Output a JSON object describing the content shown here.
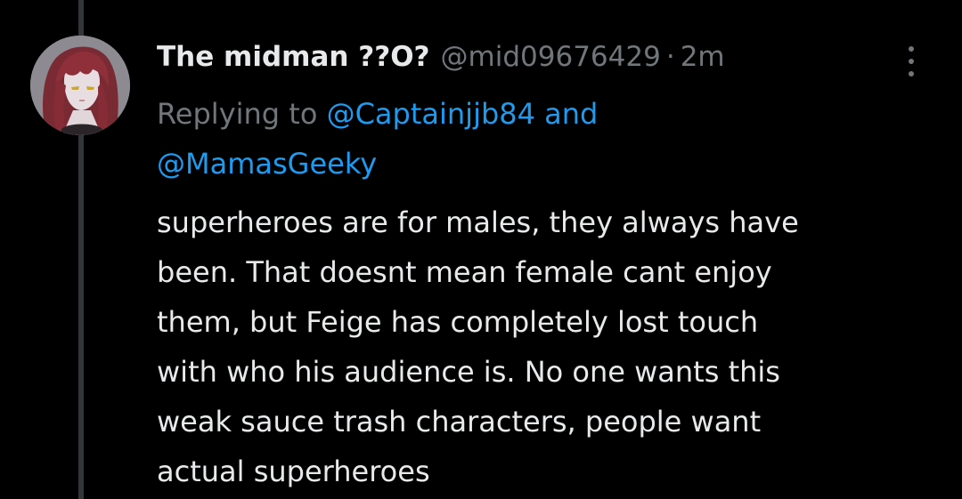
{
  "tweet": {
    "display_name": "The midman ??O?",
    "handle": "@mid09676429",
    "separator": "·",
    "time": "2m",
    "replying_prefix": "Replying to",
    "replying_mentions": [
      "@Captainjjb84",
      "@MamasGeeky"
    ],
    "replying_joiner": "and",
    "body_lines": [
      "superheroes are for males, they always have",
      "been. That doesnt mean female cant enjoy",
      "them, but Feige has completely lost touch",
      "with who his audience is. No one wants this",
      "weak sauce trash characters, people want",
      "actual superheroes"
    ]
  },
  "icons": {
    "more": "more-options-vertical-dots-icon",
    "avatar": "anime-character-avatar"
  },
  "colors": {
    "background": "#000000",
    "primary_text": "#e7e9ea",
    "secondary_text": "#71767b",
    "link": "#1d9bf0",
    "thread_line": "#333639"
  }
}
